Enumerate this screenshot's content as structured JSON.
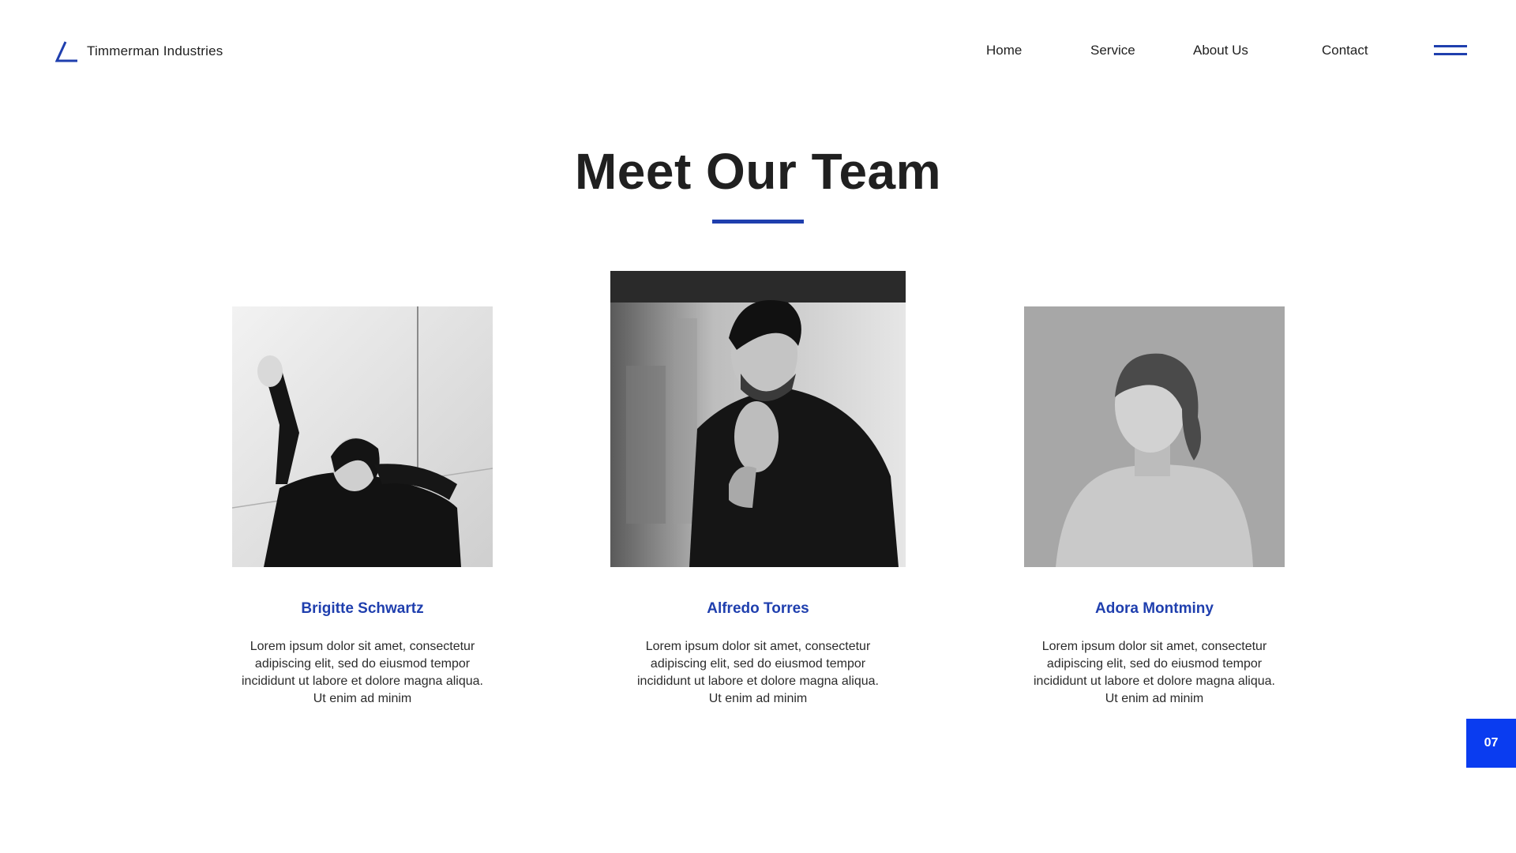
{
  "brand": {
    "name": "Timmerman Industries",
    "accent_color": "#1f3fae"
  },
  "nav": {
    "items": [
      "Home",
      "Service",
      "About Us",
      "Contact"
    ],
    "menu_icon": "hamburger-menu-icon"
  },
  "section": {
    "title": "Meet Our Team"
  },
  "team": [
    {
      "name": "Brigitte Schwartz",
      "bio": "Lorem ipsum dolor sit amet, consectetur adipiscing elit, sed do eiusmod tempor incididunt ut labore et dolore magna aliqua. Ut enim ad minim",
      "photo_icon": "woman-leaning-on-wall-photo"
    },
    {
      "name": "Alfredo Torres",
      "bio": "Lorem ipsum dolor sit amet, consectetur adipiscing elit, sed do eiusmod tempor incididunt ut labore et dolore magna aliqua. Ut enim ad minim",
      "photo_icon": "man-in-leather-jacket-photo"
    },
    {
      "name": "Adora Montminy",
      "bio": "Lorem ipsum dolor sit amet, consectetur adipiscing elit, sed do eiusmod tempor incididunt ut labore et dolore magna aliqua. Ut enim ad minim",
      "photo_icon": "woman-in-sweater-photo"
    }
  ],
  "page_number": "07"
}
